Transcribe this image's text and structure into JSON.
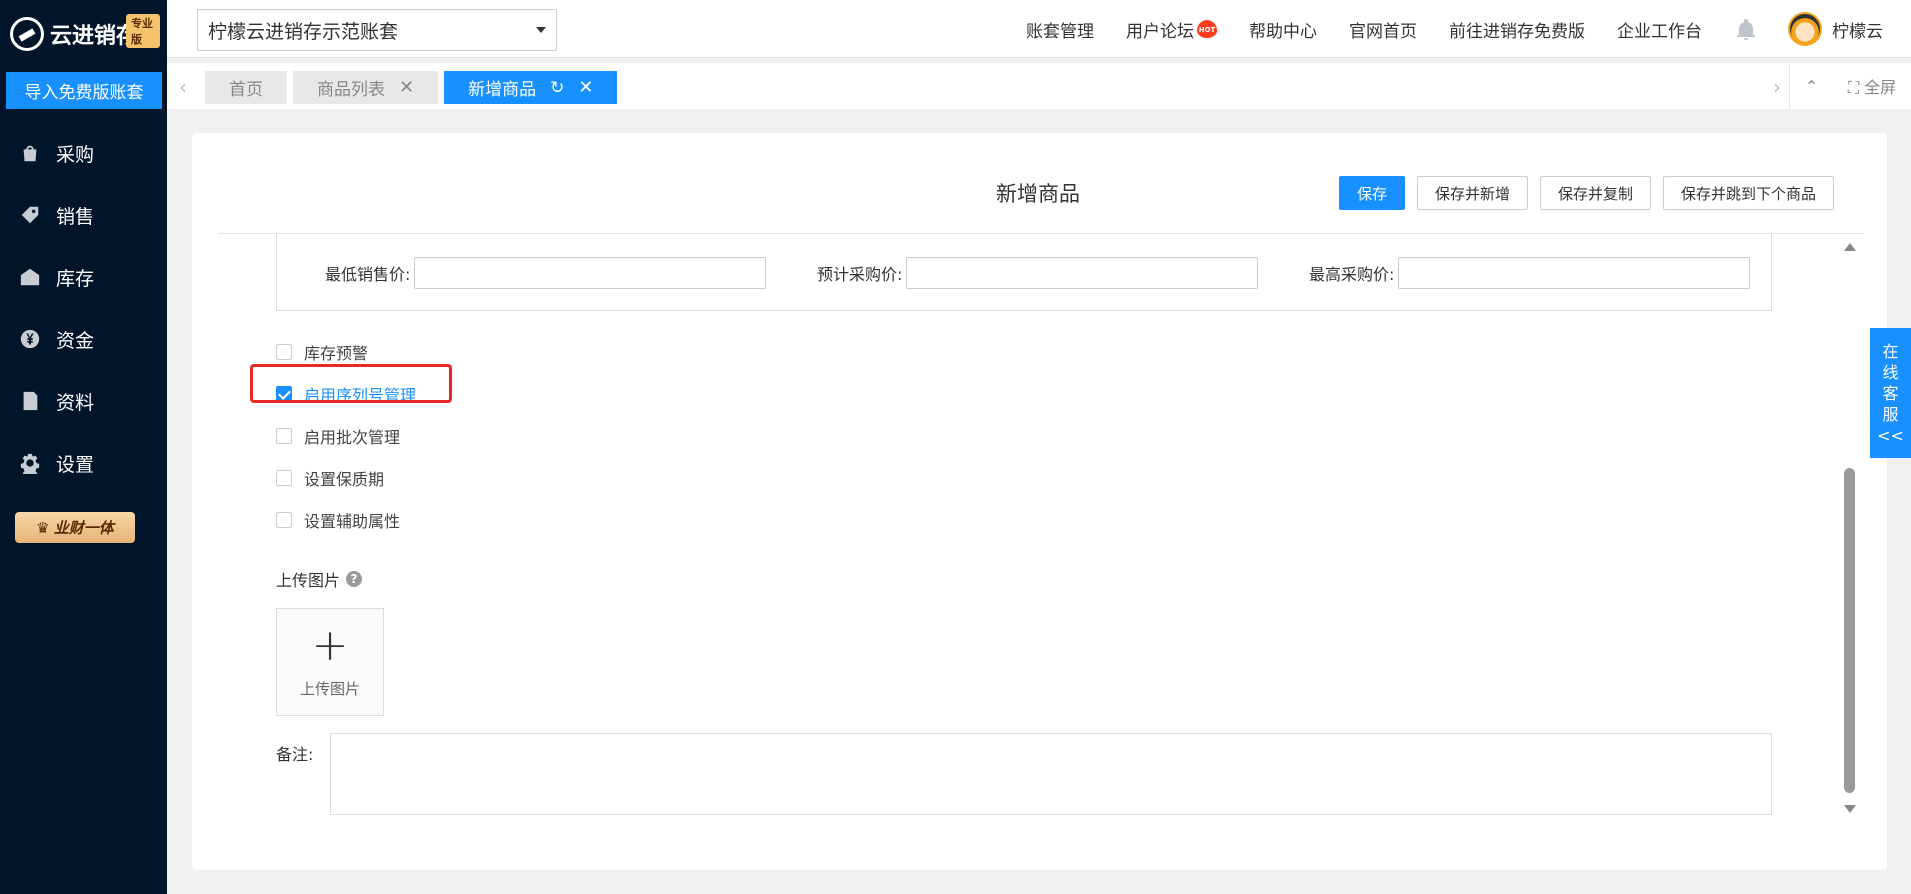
{
  "sidebar": {
    "logo_text": "云进销存",
    "logo_badge": "专业版",
    "import_button": "导入免费版账套",
    "items": [
      {
        "label": "采购",
        "icon": "shopping-bag-icon"
      },
      {
        "label": "销售",
        "icon": "tag-icon"
      },
      {
        "label": "库存",
        "icon": "warehouse-icon"
      },
      {
        "label": "资金",
        "icon": "yen-coin-icon"
      },
      {
        "label": "资料",
        "icon": "document-icon"
      },
      {
        "label": "设置",
        "icon": "gear-icon"
      }
    ],
    "promo": "业财一体"
  },
  "header": {
    "account": "柠檬云进销存示范账套",
    "nav": [
      "账套管理",
      "用户论坛",
      "帮助中心",
      "官网首页",
      "前往进销存免费版",
      "企业工作台"
    ],
    "hot_badge": "HOT",
    "user_name": "柠檬云"
  },
  "tabs": {
    "items": [
      {
        "label": "首页",
        "active": false,
        "closable": false
      },
      {
        "label": "商品列表",
        "active": false,
        "closable": true
      },
      {
        "label": "新增商品",
        "active": true,
        "closable": true
      }
    ],
    "fullscreen_label": "全屏"
  },
  "form": {
    "title": "新增商品",
    "buttons": {
      "save": "保存",
      "save_new": "保存并新增",
      "save_copy": "保存并复制",
      "save_next": "保存并跳到下个商品"
    },
    "price_fields": [
      {
        "label": "最低销售价:",
        "value": ""
      },
      {
        "label": "预计采购价:",
        "value": ""
      },
      {
        "label": "最高采购价:",
        "value": ""
      }
    ],
    "options": [
      {
        "label": "库存预警",
        "checked": false
      },
      {
        "label": "启用序列号管理",
        "checked": true
      },
      {
        "label": "启用批次管理",
        "checked": false
      },
      {
        "label": "设置保质期",
        "checked": false
      },
      {
        "label": "设置辅助属性",
        "checked": false
      }
    ],
    "upload_label": "上传图片",
    "upload_button": "上传图片",
    "remark_label": "备注:",
    "remark_value": ""
  },
  "service": {
    "lines": [
      "在",
      "线",
      "客",
      "服",
      "<<"
    ]
  },
  "colors": {
    "accent": "#1890ff",
    "sidebar": "#001529",
    "highlight": "#e62828"
  }
}
